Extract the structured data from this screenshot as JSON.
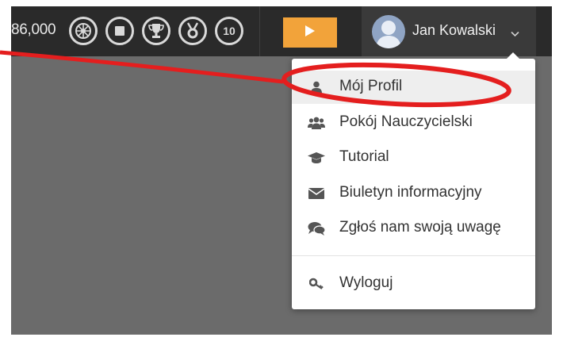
{
  "topbar": {
    "score": "86,000",
    "badges": [
      {
        "icon": "wheel-badge-icon"
      },
      {
        "icon": "stop-badge-icon"
      },
      {
        "icon": "trophy-badge-icon"
      },
      {
        "icon": "medal-badge-icon"
      },
      {
        "icon": "lifebuoy-badge-icon",
        "label": "10"
      }
    ],
    "play_icon": "play-icon",
    "play_color": "#f2a33a"
  },
  "user": {
    "name": "Jan Kowalski",
    "avatar_icon": "user-avatar-icon",
    "chevron_icon": "chevron-down-icon"
  },
  "menu": {
    "items": [
      {
        "label": "Mój Profil",
        "icon": "user-icon"
      },
      {
        "label": "Pokój Nauczycielski",
        "icon": "users-icon"
      },
      {
        "label": "Tutorial",
        "icon": "graduation-cap-icon"
      },
      {
        "label": "Biuletyn informacyjny",
        "icon": "envelope-icon"
      },
      {
        "label": "Zgłoś nam swoją uwagę",
        "icon": "comments-icon"
      },
      {
        "label": "Wyloguj",
        "icon": "key-icon"
      }
    ]
  },
  "annotation": {
    "color": "#e41e1e"
  }
}
